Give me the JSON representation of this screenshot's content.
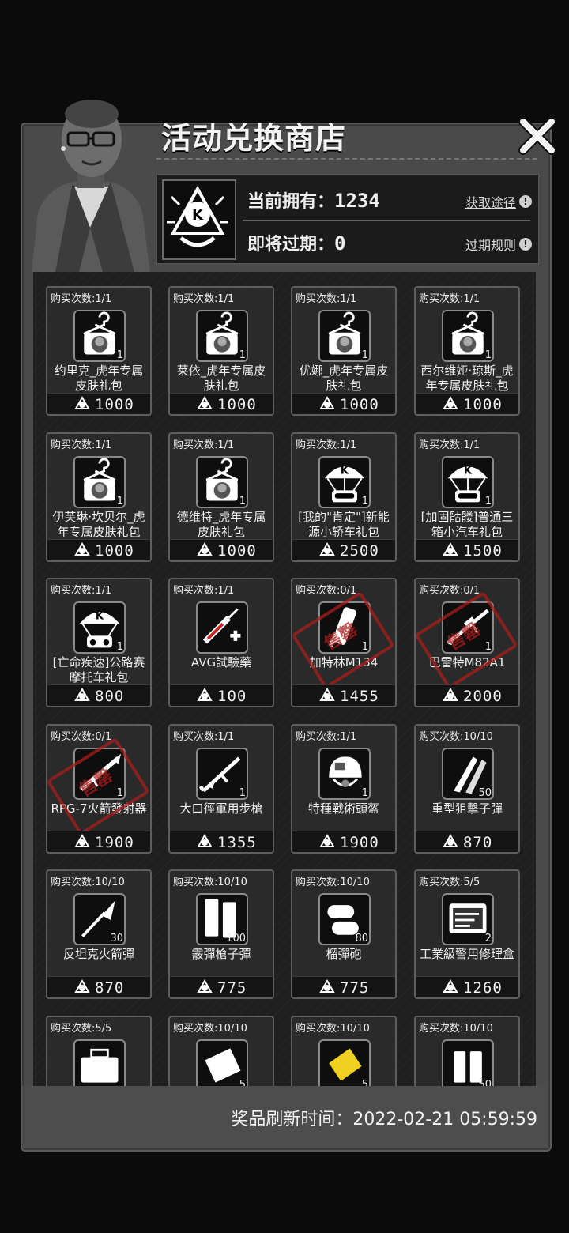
{
  "header": {
    "title": "活动兑换商店",
    "owned_label": "当前拥有：",
    "owned_value": "1234",
    "expiring_label": "即将过期：",
    "expiring_value": "0",
    "obtain_link": "获取途径",
    "expire_rules_link": "过期规则",
    "info_glyph": "!"
  },
  "footer": {
    "refresh_text": "奖品刷新时间：2022-02-21 05:59:59"
  },
  "items": [
    {
      "limit": "购买次数:1/1",
      "icon": "outfit-hanger-icon",
      "qty": "1",
      "name": "约里克_虎年专属皮肤礼包",
      "price": "1000",
      "sold": false
    },
    {
      "limit": "购买次数:1/1",
      "icon": "outfit-hanger-icon",
      "qty": "1",
      "name": "莱依_虎年专属皮肤礼包",
      "price": "1000",
      "sold": false
    },
    {
      "limit": "购买次数:1/1",
      "icon": "outfit-hanger-icon",
      "qty": "1",
      "name": "优娜_虎年专属皮肤礼包",
      "price": "1000",
      "sold": false
    },
    {
      "limit": "购买次数:1/1",
      "icon": "outfit-hanger-icon",
      "qty": "1",
      "name": "西尔维娅·琼斯_虎年专属皮肤礼包",
      "price": "1000",
      "sold": false
    },
    {
      "limit": "购买次数:1/1",
      "icon": "outfit-hanger-icon",
      "qty": "1",
      "name": "伊芙琳·坎贝尔_虎年专属皮肤礼包",
      "price": "1000",
      "sold": false
    },
    {
      "limit": "购买次数:1/1",
      "icon": "outfit-hanger-icon",
      "qty": "1",
      "name": "德维特_虎年专属皮肤礼包",
      "price": "1000",
      "sold": false
    },
    {
      "limit": "购买次数:1/1",
      "icon": "parachute-car-icon",
      "qty": "1",
      "name": "[我的\"肯定\"]新能源小轿车礼包",
      "price": "2500",
      "sold": false
    },
    {
      "limit": "购买次数:1/1",
      "icon": "parachute-car-icon",
      "qty": "1",
      "name": "[加固骷髅]普通三箱小汽车礼包",
      "price": "1500",
      "sold": false
    },
    {
      "limit": "购买次数:1/1",
      "icon": "parachute-motorbike-icon",
      "qty": "1",
      "name": "[亡命疾速]公路赛摩托车礼包",
      "price": "800",
      "sold": false
    },
    {
      "limit": "购买次数:1/1",
      "icon": "syringe-icon",
      "qty": "",
      "name": "AVG試驗藥",
      "price": "100",
      "sold": false
    },
    {
      "limit": "购买次数:0/1",
      "icon": "minigun-icon",
      "qty": "1",
      "name": "加特林M134",
      "price": "1455",
      "sold": true
    },
    {
      "limit": "购买次数:0/1",
      "icon": "sniper-rifle-icon",
      "qty": "1",
      "name": "巴雷特M82A1",
      "price": "2000",
      "sold": true
    },
    {
      "limit": "购买次数:0/1",
      "icon": "rocket-launcher-icon",
      "qty": "1",
      "name": "RPG-7火箭發射器",
      "price": "1900",
      "sold": true
    },
    {
      "limit": "购买次数:1/1",
      "icon": "assault-rifle-icon",
      "qty": "1",
      "name": "大口徑軍用步槍",
      "price": "1355",
      "sold": false
    },
    {
      "limit": "购买次数:1/1",
      "icon": "tactical-helmet-icon",
      "qty": "1",
      "name": "特種戰術頭盔",
      "price": "1900",
      "sold": false
    },
    {
      "limit": "购买次数:10/10",
      "icon": "sniper-ammo-icon",
      "qty": "50",
      "name": "重型狙擊子彈",
      "price": "870",
      "sold": false
    },
    {
      "limit": "购买次数:10/10",
      "icon": "rocket-ammo-icon",
      "qty": "30",
      "name": "反坦克火箭彈",
      "price": "870",
      "sold": false
    },
    {
      "limit": "购买次数:10/10",
      "icon": "shotgun-shells-icon",
      "qty": "100",
      "name": "霰彈槍子彈",
      "price": "775",
      "sold": false
    },
    {
      "limit": "购买次数:10/10",
      "icon": "grenade-shells-icon",
      "qty": "80",
      "name": "榴彈砲",
      "price": "775",
      "sold": false
    },
    {
      "limit": "购买次数:5/5",
      "icon": "repair-kit-icon",
      "qty": "2",
      "name": "工業級警用修理盒",
      "price": "1260",
      "sold": false
    },
    {
      "limit": "购买次数:5/5",
      "icon": "toolbox-icon",
      "qty": "",
      "name": "",
      "price": "",
      "sold": false
    },
    {
      "limit": "购买次数:10/10",
      "icon": "bandage-icon",
      "qty": "5",
      "name": "",
      "price": "",
      "sold": false
    },
    {
      "limit": "购买次数:10/10",
      "icon": "yellow-card-icon",
      "qty": "5",
      "name": "",
      "price": "",
      "sold": false
    },
    {
      "limit": "购买次数:10/10",
      "icon": "battery-icon",
      "qty": "50",
      "name": "",
      "price": "",
      "sold": false
    }
  ],
  "sold_stamp_text": "售罄",
  "colors": {
    "panel": "#4a4a4a",
    "card": "#2a2a2a",
    "stamp": "#aa1e1e"
  }
}
